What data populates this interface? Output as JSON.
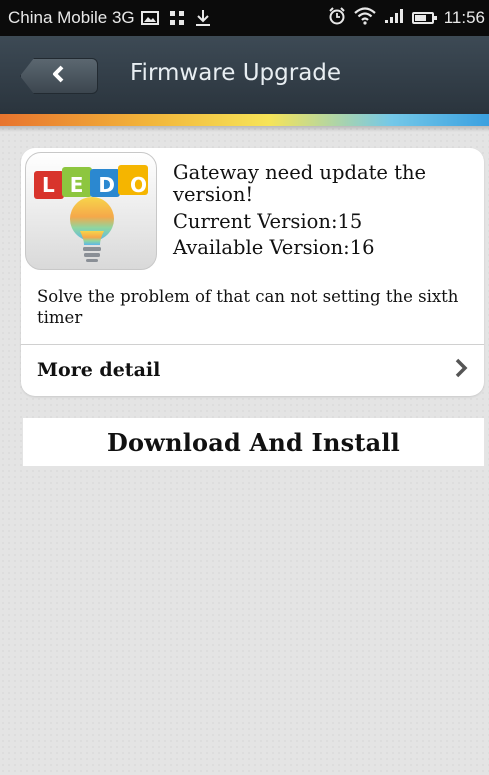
{
  "status_bar": {
    "carrier": "China Mobile 3G",
    "time": "11:56",
    "icons": [
      "image-icon",
      "grid-icon",
      "download-icon",
      "alarm-icon",
      "wifi-icon",
      "signal-icon",
      "battery-icon"
    ]
  },
  "header": {
    "title": "Firmware Upgrade",
    "back_icon": "back-arrow-icon"
  },
  "update_card": {
    "app_icon_text": "LEDO",
    "headline": "Gateway need update the version!",
    "current_version": "Current Version:15",
    "available_version": "Available Version:16",
    "description": "Solve the problem of that can not setting the sixth timer",
    "more_detail_label": "More detail"
  },
  "actions": {
    "download_label": "Download And Install"
  },
  "colors": {
    "status_bar_bg": "#0b0b0b",
    "title_bar_bg": "#2f3a43",
    "page_bg": "#e4e4e4",
    "card_bg": "#ffffff"
  }
}
